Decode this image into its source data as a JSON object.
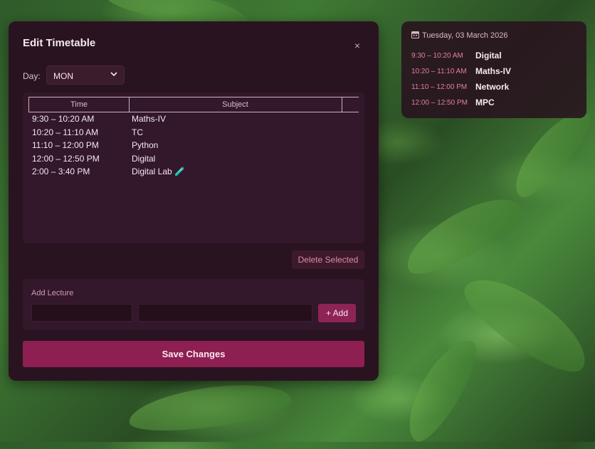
{
  "dialog": {
    "title": "Edit Timetable",
    "close_glyph": "×",
    "day_label": "Day:",
    "day_value": "MON",
    "table": {
      "headers": [
        "Time",
        "Subject"
      ],
      "rows": [
        {
          "time": "9:30 – 10:20 AM",
          "subject": "Maths-IV"
        },
        {
          "time": "10:20 – 11:10 AM",
          "subject": "TC"
        },
        {
          "time": "11:10 – 12:00 PM",
          "subject": "Python"
        },
        {
          "time": "12:00 – 12:50 PM",
          "subject": "Digital"
        },
        {
          "time": "2:00 – 3:40 PM",
          "subject": "Digital Lab 🧪"
        }
      ]
    },
    "delete_label": "Delete Selected",
    "add_lecture_title": "Add Lecture",
    "add_time_value": "",
    "add_subject_value": "",
    "add_button": "+ Add",
    "save_button": "Save Changes"
  },
  "widget": {
    "date": "Tuesday, 03 March 2026",
    "rows": [
      {
        "time": "9:30 – 10:20 AM",
        "subject": "Digital"
      },
      {
        "time": "10:20 – 11:10 AM",
        "subject": "Maths-IV"
      },
      {
        "time": "11:10 – 12:00 PM",
        "subject": "Network"
      },
      {
        "time": "12:00 – 12:50 PM",
        "subject": "MPC"
      }
    ]
  },
  "colors": {
    "accent": "#8e1f52",
    "panel": "#2a1320",
    "time_text": "#e27fa4"
  },
  "icons": {
    "close": "close-icon",
    "day_dropdown": "chevron-down-icon",
    "widget_calendar": "calendar-icon"
  }
}
